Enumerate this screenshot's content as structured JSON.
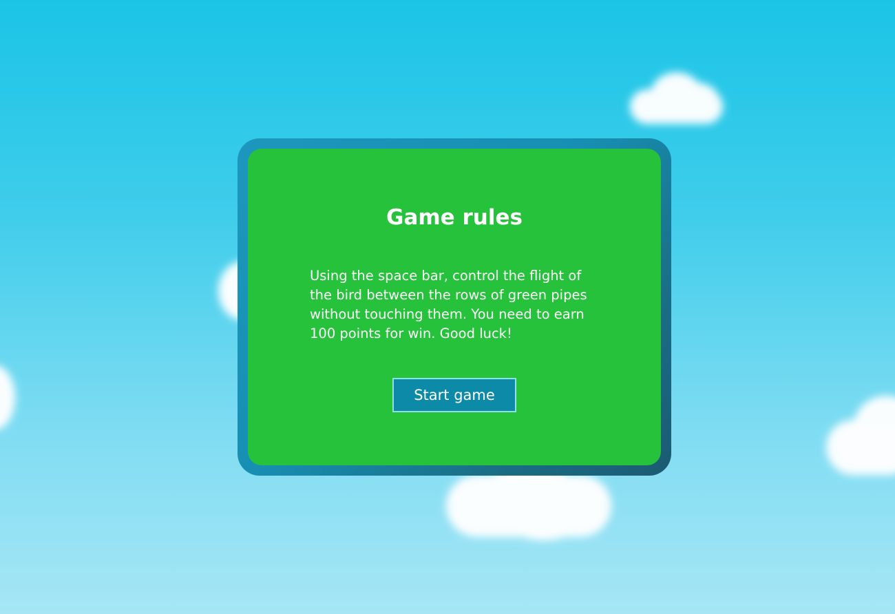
{
  "scene": {
    "background_colors": [
      "#1bc4e6",
      "#a6e6f5"
    ],
    "cloud_color": "#ffffff"
  },
  "rules_panel": {
    "title": "Game rules",
    "description": "Using the space bar, control the flight of the bird between the rows of green pipes without touching them. You need to earn 100 points for win. Good luck!",
    "panel_color": "#27c23b",
    "frame_color": "#178fb3"
  },
  "start_button": {
    "label": "Start game",
    "color": "#0e8aa9"
  }
}
